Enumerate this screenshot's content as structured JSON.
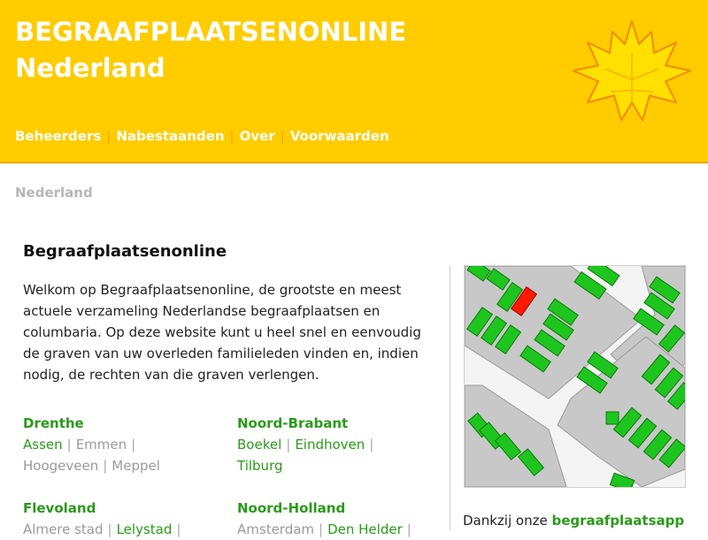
{
  "header": {
    "title_line1": "BEGRAAFPLAATSENONLINE",
    "title_line2": "Nederland",
    "logo": "maple-leaf-icon",
    "nav": [
      "Beheerders",
      "Nabestaanden",
      "Over",
      "Voorwaarden"
    ],
    "nav_separator": "|"
  },
  "breadcrumb": "Nederland",
  "main": {
    "heading": "Begraafplaatsenonline",
    "intro": "Welkom op Begraafplaatsenonline, de grootste en meest actuele verzameling Nederlandse begraafplaatsen en columbaria. Op deze website kunt u heel snel en eenvoudig de graven van uw overleden familieleden vinden en, indien nodig, de rechten van die graven verlengen."
  },
  "provinces": [
    {
      "name": "Drenthe",
      "places": [
        {
          "label": "Assen",
          "available": true
        },
        {
          "label": "Emmen",
          "available": false
        },
        {
          "label": "Hoogeveen",
          "available": false
        },
        {
          "label": "Meppel",
          "available": false
        }
      ]
    },
    {
      "name": "Noord-Brabant",
      "places": [
        {
          "label": "Boekel",
          "available": true
        },
        {
          "label": "Eindhoven",
          "available": true
        },
        {
          "label": "Tilburg",
          "available": true
        }
      ]
    },
    {
      "name": "Flevoland",
      "places": [
        {
          "label": "Almere stad",
          "available": false
        },
        {
          "label": "Lelystad",
          "available": true
        }
      ]
    },
    {
      "name": "Noord-Holland",
      "places": [
        {
          "label": "Amsterdam",
          "available": false
        },
        {
          "label": "Den Helder",
          "available": true
        }
      ]
    }
  ],
  "place_separator": "|",
  "sidebar": {
    "map_icon": "cemetery-map-graphic",
    "app_prefix": "Dankzij onze ",
    "app_link": "begraafplaatsapp"
  },
  "colors": {
    "header_yellow": "#ffcc00",
    "link_green": "#2a9a1a",
    "inactive_gray": "#9a9a9a",
    "grave_green": "#1ec51e",
    "grave_selected": "#ff1a00"
  }
}
